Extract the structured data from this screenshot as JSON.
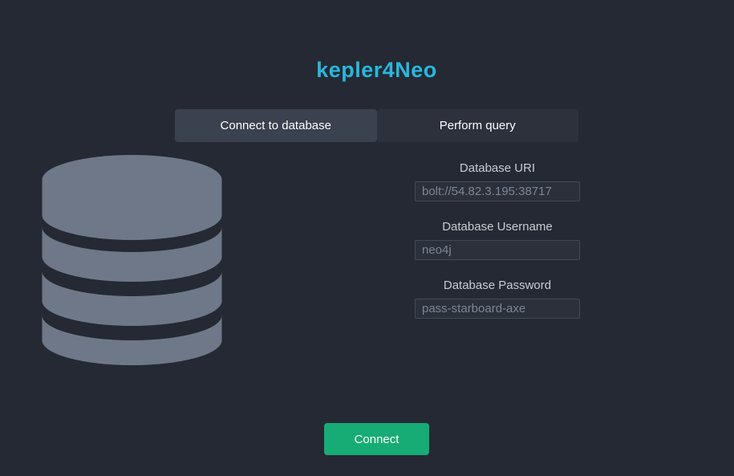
{
  "app": {
    "title": "kepler4Neo"
  },
  "tabs": [
    {
      "label": "Connect to database",
      "active": true
    },
    {
      "label": "Perform query",
      "active": false
    }
  ],
  "form": {
    "fields": [
      {
        "label": "Database URI",
        "value": "bolt://54.82.3.195:38717"
      },
      {
        "label": "Database Username",
        "value": "neo4j"
      },
      {
        "label": "Database Password",
        "value": "pass-starboard-axe"
      }
    ],
    "connect_label": "Connect"
  },
  "icons": {
    "database_icon": "database-cylinder"
  },
  "colors": {
    "background": "#252933",
    "title": "#29b7dd",
    "tab_active_bg": "#39424e",
    "tab_inactive_bg": "#2c313c",
    "tab_text": "#fdfdfd",
    "label_text": "#c8ccd3",
    "input_bg": "#2b303a",
    "input_border": "#414a57",
    "input_text": "#7d8697",
    "icon_fill": "#6e7889",
    "button_bg": "#17ab75",
    "button_text": "#ffffff"
  }
}
